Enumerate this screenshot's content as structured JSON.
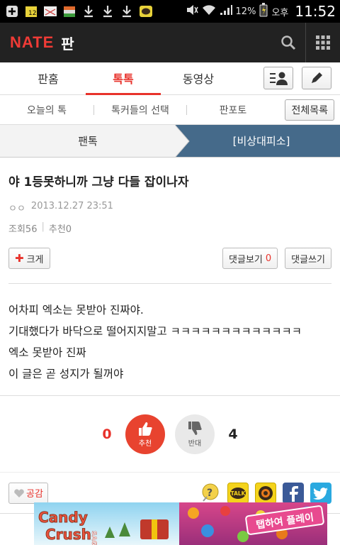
{
  "status_bar": {
    "battery": "12%",
    "ampm": "오후",
    "time": "11:52"
  },
  "header": {
    "logo": "NATE",
    "section": "판"
  },
  "tabs": [
    {
      "label": "판홈"
    },
    {
      "label": "톡톡"
    },
    {
      "label": "동영상"
    }
  ],
  "subnav": {
    "items": [
      "오늘의 톡",
      "톡커들의 선택",
      "판포토"
    ],
    "all_list": "전체목록"
  },
  "boards": {
    "left": "팬톡",
    "right": "[비상대피소]"
  },
  "post": {
    "title": "야 1등못하니까 그냥 다들 잡이나자",
    "author": "ㅇㅇ",
    "date": "2013.12.27 23:51",
    "views": "조회56",
    "recommends": "추천0",
    "enlarge": "크게",
    "view_comments": "댓글보기",
    "comment_count": "0",
    "write_comment": "댓글쓰기",
    "body": [
      "어차피 엑소는 못받아 진짜야.",
      "기대했다가 바닥으로 떨어지지말고 ㅋㅋㅋㅋㅋㅋㅋㅋㅋㅋㅋㅋㅋ",
      "엑소 못받아 진짜",
      "이 글은 곧 성지가 될꺼야"
    ]
  },
  "vote": {
    "up_count": "0",
    "up_label": "추천",
    "down_label": "반대",
    "down_count": "4"
  },
  "share": {
    "empathy": "공감",
    "kakao_label": "TALK",
    "icons": [
      "memo-icon",
      "kakaotalk-icon",
      "kakaostory-icon",
      "facebook-icon",
      "twitter-icon"
    ]
  },
  "ad": {
    "brand_top": "Candy",
    "brand_bottom": "Crush",
    "saga": "SAGA",
    "cta": "탭하여 플레이"
  },
  "colors": {
    "accent": "#e8322b",
    "header_bg": "#222222",
    "board_active": "#456a8a"
  }
}
